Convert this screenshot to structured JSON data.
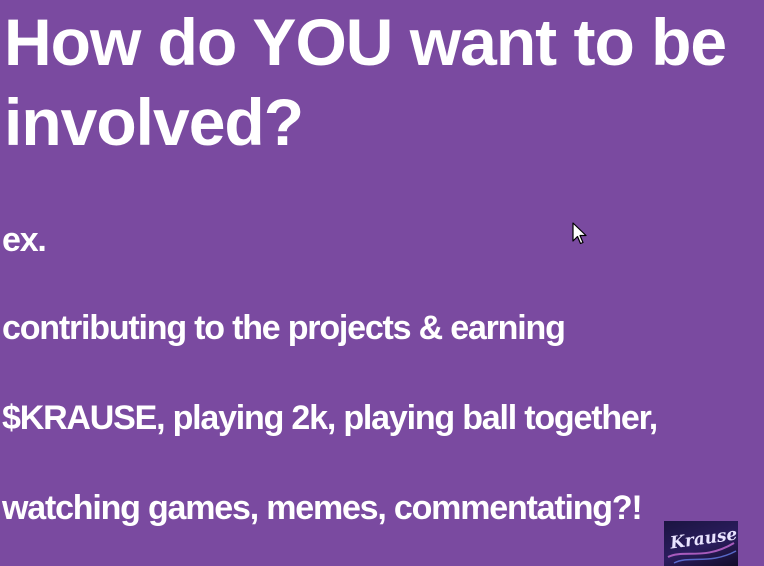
{
  "slide": {
    "title": "How do YOU want to be involved?",
    "lines": [
      "ex.",
      "contributing to the projects & earning",
      "$KRAUSE, playing 2k, playing ball together,",
      "watching games, memes, commentating?!"
    ],
    "background_color": "#7a4aa0",
    "text_color": "#ffffff"
  },
  "logo": {
    "text": "Krause",
    "icon": "krause-logo-icon"
  },
  "cursor": {
    "icon": "mouse-pointer-icon"
  }
}
